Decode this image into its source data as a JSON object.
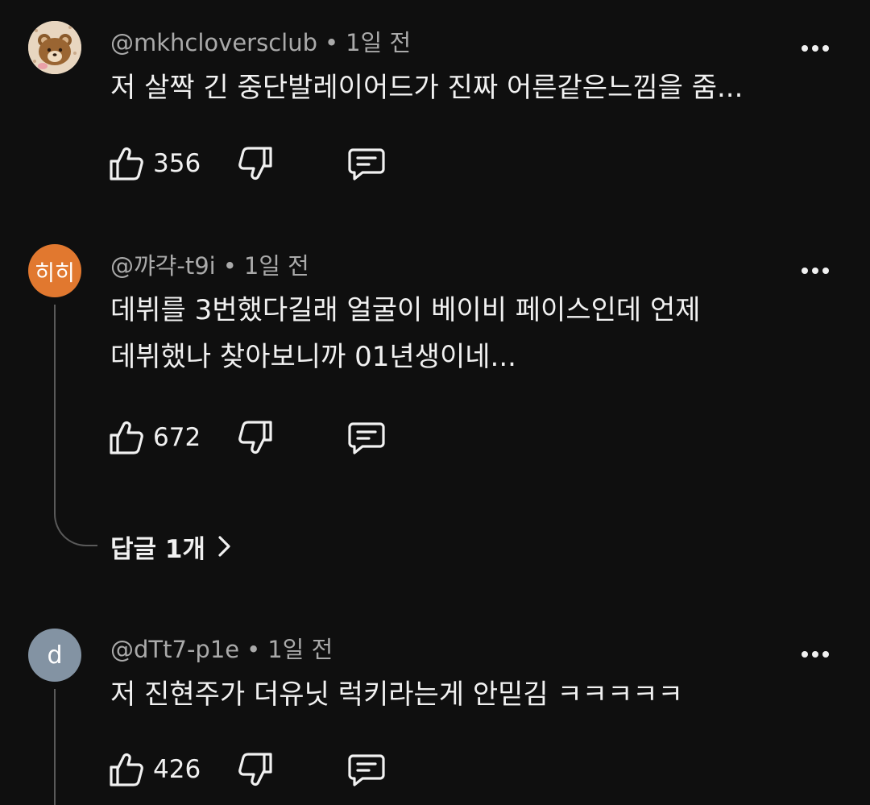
{
  "comments": [
    {
      "avatar_type": "image",
      "avatar_description": "rilakkuma-bear",
      "username": "@mkhcloversclub",
      "time": "1일 전",
      "lines": [
        "저 살짝 긴 중단발레이어드가 진짜 어른같은느낌을 줌..."
      ],
      "likes": "356"
    },
    {
      "avatar_type": "text",
      "avatar_text": "히히",
      "avatar_color": "#e1782f",
      "username": "@꺄갹-t9i",
      "time": "1일 전",
      "lines": [
        "데뷔를 3번했다길래 얼굴이 베이비 페이스인데 언제",
        "데뷔했나 찾아보니까 01년생이네..."
      ],
      "likes": "672",
      "replies_label": "답글 1개"
    },
    {
      "avatar_type": "text",
      "avatar_text": "d",
      "avatar_color": "#8393a3",
      "username": "@dTt7-p1e",
      "time": "1일 전",
      "lines": [
        "저 진현주가 더유닛 럭키라는게 안믿김 ㅋㅋㅋㅋㅋ"
      ],
      "likes": "426"
    }
  ],
  "meta_separator": "•",
  "icons": {
    "like": "thumbs-up-icon",
    "dislike": "thumbs-down-icon",
    "reply": "comment-reply-icon",
    "more": "more-vertical-icon",
    "chevron": "chevron-right-icon"
  }
}
